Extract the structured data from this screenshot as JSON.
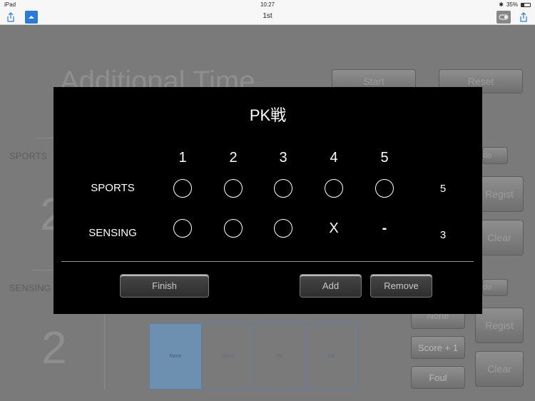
{
  "status": {
    "device": "iPad",
    "time": "10:27",
    "battery": "35%"
  },
  "nav": {
    "title": "1st"
  },
  "background": {
    "heading": "Additional Time",
    "start_label": "Start",
    "reset_label": "Reset",
    "sports_label": "SPORTS",
    "sensing_label": "SENSING",
    "sports_score": "2",
    "sensing_score": "2",
    "undo_label": "do",
    "regist_label": "Regist",
    "clear_label": "Clear",
    "none_label": "None",
    "score_plus_label": "Score + 1",
    "foul_label": "Foul",
    "grid_cells": [
      "None",
      "Shoot",
      "FK",
      "CK"
    ]
  },
  "modal": {
    "title": "PK戦",
    "columns": [
      "1",
      "2",
      "3",
      "4",
      "5"
    ],
    "rows": [
      {
        "label": "SPORTS",
        "marks": [
          "circle",
          "circle",
          "circle",
          "circle",
          "circle"
        ],
        "total": "5"
      },
      {
        "label": "SENSING",
        "marks": [
          "circle",
          "circle",
          "circle",
          "X",
          "-"
        ],
        "total": "3"
      }
    ],
    "finish_label": "Finish",
    "add_label": "Add",
    "remove_label": "Remove"
  }
}
